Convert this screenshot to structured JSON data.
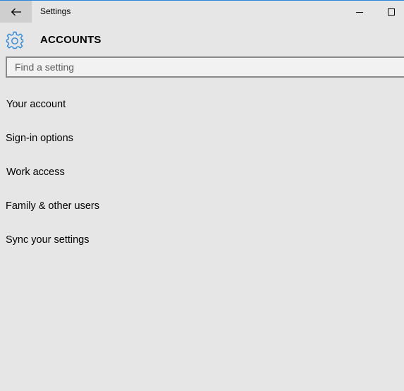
{
  "window": {
    "title": "Settings",
    "accent_color": "#2b88d8",
    "background": "#e6e6e6"
  },
  "titlebar": {
    "back_icon": "arrow-left-icon",
    "minimize_icon": "minimize-icon",
    "maximize_icon": "maximize-icon"
  },
  "header": {
    "icon": "gear-icon",
    "title": "ACCOUNTS"
  },
  "search": {
    "value": "",
    "placeholder": "Find a setting"
  },
  "nav": {
    "items": [
      {
        "label": "Your account"
      },
      {
        "label": "Sign-in options"
      },
      {
        "label": "Work access"
      },
      {
        "label": "Family & other users"
      },
      {
        "label": "Sync your settings"
      }
    ]
  }
}
